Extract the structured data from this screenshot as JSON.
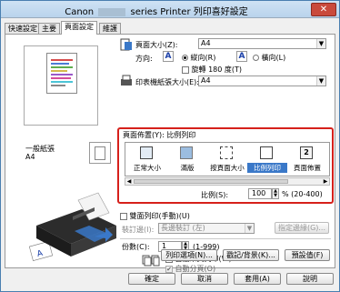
{
  "window": {
    "title_left": "Canon",
    "title_right": "series Printer 列印喜好設定",
    "close_label": "✕"
  },
  "tabs": [
    {
      "label": "快速設定"
    },
    {
      "label": "主要"
    },
    {
      "label": "頁面設定"
    },
    {
      "label": "維護"
    }
  ],
  "preview": {
    "media_type": "一般紙張",
    "paper_size": "A4"
  },
  "page_size": {
    "label": "頁面大小(Z):",
    "value": "A4"
  },
  "orientation": {
    "label": "方向:",
    "portrait": "縱向(R)",
    "landscape": "橫向(L)",
    "rotate": "旋轉 180 度(T)"
  },
  "printer_paper_size": {
    "label": "印表機紙張大小(E):",
    "value": "A4"
  },
  "page_layout": {
    "label": "頁面佈置(Y):",
    "current": "比例列印",
    "items": [
      {
        "label": "正常大小"
      },
      {
        "label": "滿版"
      },
      {
        "label": "按頁面大小"
      },
      {
        "label": "比例列印"
      },
      {
        "label": "頁面佈置"
      }
    ],
    "scaling_label": "比例(S):",
    "scaling_value": "100",
    "scaling_range": "% (20-400)"
  },
  "duplex": {
    "label": "雙面列印(手動)(U)",
    "stapling_label": "裝訂邊(I):",
    "stapling_value": "長邊裝訂 (左)",
    "margin_button": "指定邊緣(G)..."
  },
  "copies": {
    "label": "份數(C):",
    "value": "1",
    "range": "(1-999)",
    "print_from_last": "自最末頁列印(W)",
    "collate": "自動分頁(O)"
  },
  "panel_buttons": {
    "print_options": "列印選項(N)...",
    "stamp": "戳記/背景(K)...",
    "defaults": "預設值(F)"
  },
  "dialog_buttons": {
    "ok": "確定",
    "cancel": "取消",
    "apply": "套用(A)",
    "help": "說明"
  }
}
